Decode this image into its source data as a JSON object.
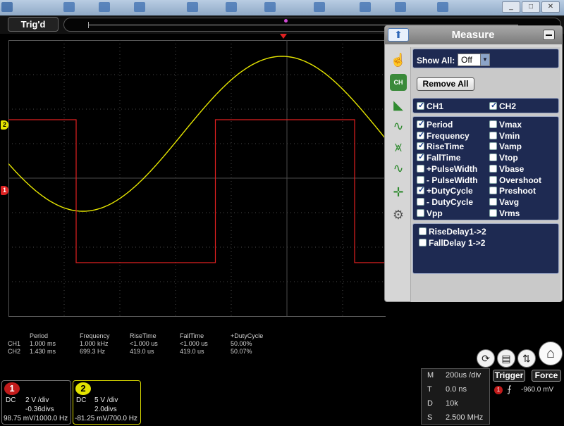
{
  "trig_bar": {
    "status": "Trig'd"
  },
  "window_buttons": {
    "minimize": "_",
    "restore": "□",
    "close": "✕"
  },
  "colors": {
    "ch1": "#e02020",
    "ch2": "#e6e600",
    "grid": "#4a4a4a",
    "panel_section": "#1e2a52"
  },
  "channel_markers": {
    "ch1": "1",
    "ch2": "2"
  },
  "measure": {
    "title": "Measure",
    "show_all_label": "Show All:",
    "show_all_value": "Off",
    "remove_all": "Remove All",
    "channels": [
      {
        "label": "CH1",
        "checked": true
      },
      {
        "label": "CH2",
        "checked": true
      }
    ],
    "params_left": [
      {
        "label": "Period",
        "checked": true
      },
      {
        "label": "Frequency",
        "checked": true
      },
      {
        "label": "RiseTime",
        "checked": true
      },
      {
        "label": "FallTime",
        "checked": true
      },
      {
        "label": "+PulseWidth",
        "checked": false
      },
      {
        "label": "- PulseWidth",
        "checked": false
      },
      {
        "label": "+DutyCycle",
        "checked": true
      },
      {
        "label": "- DutyCycle",
        "checked": false
      },
      {
        "label": "Vpp",
        "checked": false
      }
    ],
    "params_right": [
      {
        "label": "Vmax",
        "checked": false
      },
      {
        "label": "Vmin",
        "checked": false
      },
      {
        "label": "Vamp",
        "checked": false
      },
      {
        "label": "Vtop",
        "checked": false
      },
      {
        "label": "Vbase",
        "checked": false
      },
      {
        "label": "Overshoot",
        "checked": false
      },
      {
        "label": "Preshoot",
        "checked": false
      },
      {
        "label": "Vavg",
        "checked": false
      },
      {
        "label": "Vrms",
        "checked": false
      }
    ],
    "delays": [
      {
        "label": "RiseDelay1->2",
        "checked": false
      },
      {
        "label": "FallDelay 1->2",
        "checked": false
      }
    ],
    "side_icons": [
      "pointer-icon",
      "channel-icon",
      "trigger-icon",
      "math-icon",
      "fft-icon",
      "ref-icon",
      "cursor-icon",
      "settings-icon"
    ]
  },
  "readout": {
    "headers": [
      "Period",
      "Frequency",
      "RiseTime",
      "FallTime",
      "+DutyCycle"
    ],
    "rows": [
      {
        "channel": "CH1",
        "values": [
          "1.000 ms",
          "1.000 kHz",
          "<1.000 us",
          "<1.000 us",
          "50.00%"
        ]
      },
      {
        "channel": "CH2",
        "values": [
          "1.430 ms",
          "699.3 Hz",
          "419.0 us",
          "419.0 us",
          "50.07%"
        ]
      }
    ]
  },
  "ch1_box": {
    "badge": "1",
    "coupling": "DC",
    "scale": "2 V /div",
    "offset": "-0.36divs",
    "probe": "98.75 mV/1000.0 Hz"
  },
  "ch2_box": {
    "badge": "2",
    "coupling": "DC",
    "scale": "5 V /div",
    "offset": "2.0divs",
    "probe": "-81.25 mV/700.0 Hz"
  },
  "timebase": {
    "rows": [
      {
        "key": "M",
        "value": "200us /div"
      },
      {
        "key": "T",
        "value": "0.0 ns"
      },
      {
        "key": "D",
        "value": "10k"
      },
      {
        "key": "S",
        "value": "2.500 MHz"
      }
    ]
  },
  "trigger": {
    "trigger_label": "Trigger",
    "force_label": "Force",
    "source": "1",
    "level": "-960.0 mV"
  }
}
